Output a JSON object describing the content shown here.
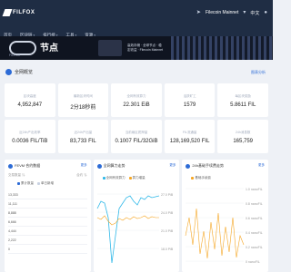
{
  "header": {
    "logo_text": "FILFOX",
    "network": "Filecoin Mainnet",
    "language": "中文"
  },
  "nav": {
    "items": [
      "首页",
      "区块链",
      "排行榜",
      "工具",
      "资源"
    ]
  },
  "banner": {
    "title": "节点",
    "text": "高效存储 · 全球节点 · 稳定收益 · Filecoin Mainnet",
    "sub": "FILFOX"
  },
  "overview": {
    "title": "全网概览",
    "more": "图表分析"
  },
  "stats": [
    {
      "label": "区块高度",
      "value": "4,952,847"
    },
    {
      "label": "最新区块时间",
      "value": "2分18秒前"
    },
    {
      "label": "全网有效算力",
      "value": "22.301 EiB"
    },
    {
      "label": "活跃矿工",
      "value": "1579"
    },
    {
      "label": "每区块奖励",
      "value": "5.8611 FIL"
    },
    {
      "label": "近24h产出效率",
      "value": "0.0036 FIL/TiB"
    },
    {
      "label": "近24h产出量",
      "value": "83,733 FIL"
    },
    {
      "label": "当前扇区质押量",
      "value": "0.1007 FIL/32GiB"
    },
    {
      "label": "FIL流通量",
      "value": "128,169,520 FIL"
    },
    {
      "label": "24h消息数",
      "value": "165,759"
    }
  ],
  "panels": {
    "fdvm": {
      "title": "FEVM 合约数据",
      "link": "更多",
      "columns": [
        "交易数量 ⇅",
        "合约 ⇅"
      ],
      "legend": [
        "累计数量",
        "单日新增"
      ],
      "rows": [
        "13,333",
        "11,111",
        "8,888",
        "6,666",
        "4,444",
        "2,222",
        "0"
      ]
    },
    "power": {
      "title": "全网算力走势",
      "link": "更多",
      "legend": [
        "全网有效算力",
        "算力增量"
      ],
      "right_ticks": [
        "27.0 PiB",
        "24.0 PiB",
        "21.0 PiB",
        "18.0 PiB"
      ]
    },
    "gas": {
      "title": "24h基础手续费走势",
      "link": "更多",
      "legend": [
        "基础手续费"
      ],
      "right_ticks": [
        "1.0 nanoFIL",
        "0.8 nanoFIL",
        "0.6 nanoFIL",
        "0.4 nanoFIL",
        "0.2 nanoFIL",
        "0 nanoFIL"
      ]
    }
  },
  "colors": {
    "header_bg": "#1f2d44",
    "accent": "#2c6bd6",
    "line_cyan": "#2fb8e8",
    "line_orange": "#f5a623"
  }
}
